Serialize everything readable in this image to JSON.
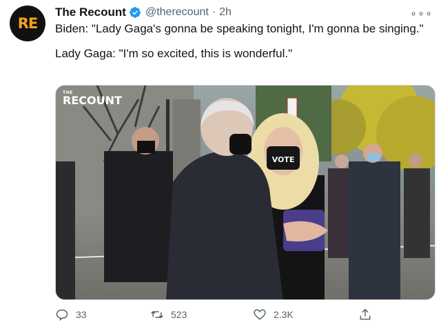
{
  "account": {
    "avatar_text": "RE",
    "display_name": "The Recount",
    "handle": "@therecount",
    "separator": "·",
    "time": "2h",
    "more_icon": "more-horizontal-icon",
    "verified_icon": "verified-badge-icon"
  },
  "tweet": {
    "paragraph_1": "Biden: \"Lady Gaga's gonna be speaking tonight, I'm gonna be singing.\"",
    "paragraph_2": "Lady Gaga: \"I'm so excited, this is wonderful.\""
  },
  "media": {
    "watermark_small": "THE",
    "watermark_big": "RECOUNT",
    "mask_text": "VOTE"
  },
  "actions": {
    "reply_count": "33",
    "retweet_count": "523",
    "like_count": "2.3K"
  },
  "colors": {
    "accent": "#1d9bf0",
    "muted": "#536471",
    "brand_orange": "#f6a21e"
  }
}
